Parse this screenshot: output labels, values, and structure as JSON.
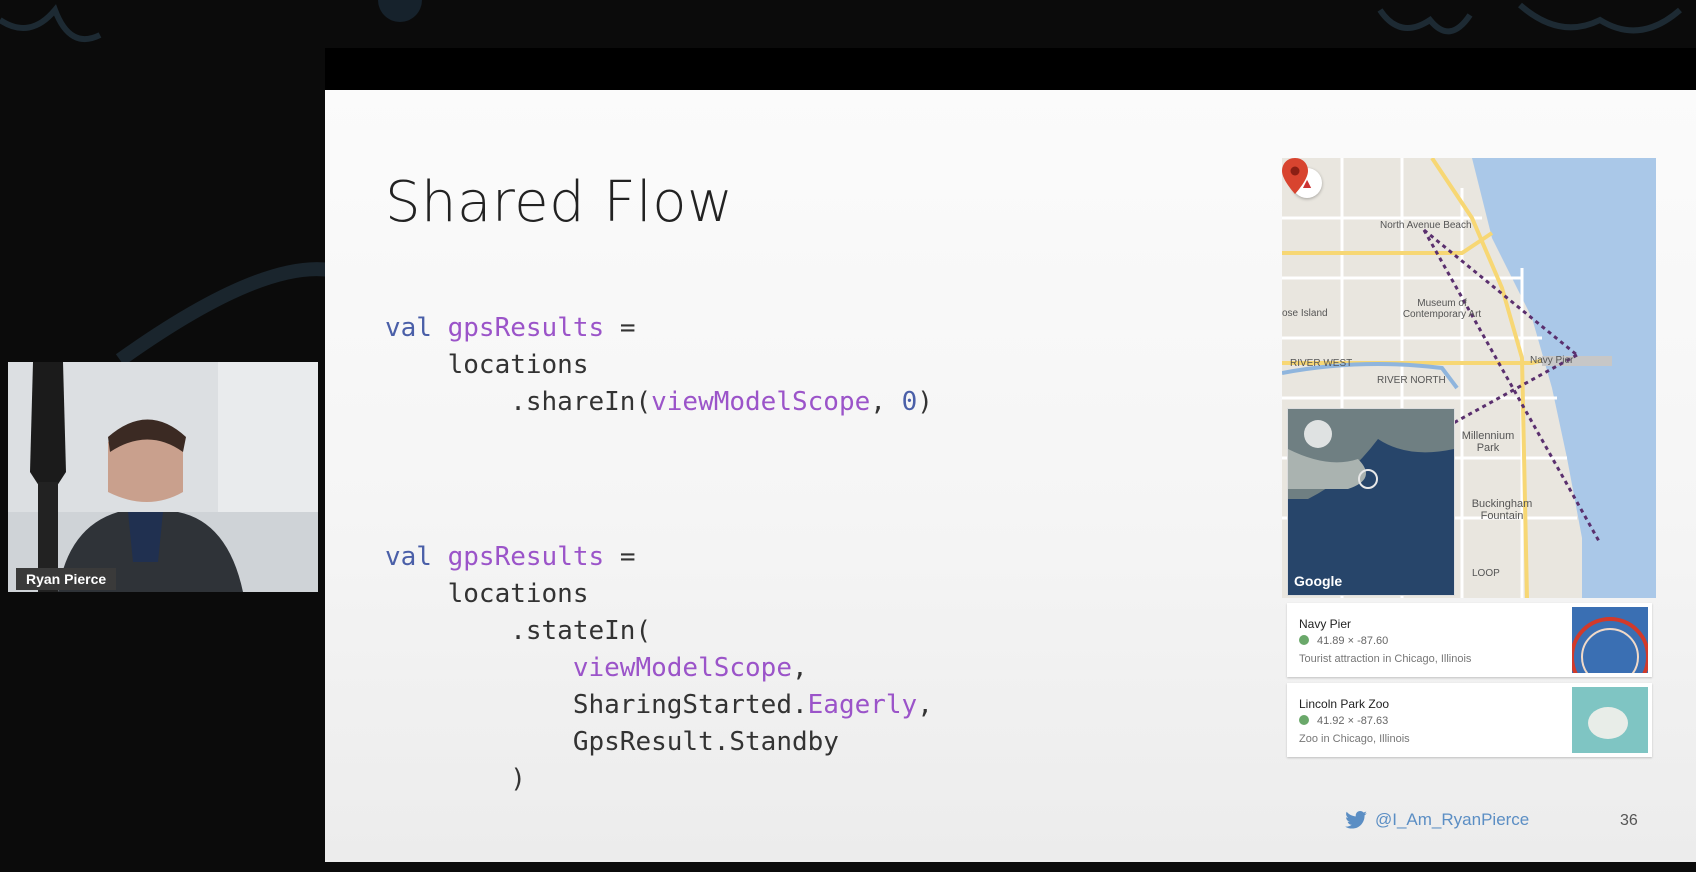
{
  "slide": {
    "title": "Shared Flow",
    "code_block_1": [
      [
        {
          "t": "val",
          "c": "kw"
        },
        {
          "t": " "
        },
        {
          "t": "gpsResults",
          "c": "id"
        },
        {
          "t": " ="
        }
      ],
      [
        {
          "t": "    locations"
        }
      ],
      [
        {
          "t": "        .shareIn("
        },
        {
          "t": "viewModelScope",
          "c": "id"
        },
        {
          "t": ", "
        },
        {
          "t": "0",
          "c": "num"
        },
        {
          "t": ")"
        }
      ]
    ],
    "code_block_2": [
      [
        {
          "t": "val",
          "c": "kw"
        },
        {
          "t": " "
        },
        {
          "t": "gpsResults",
          "c": "id"
        },
        {
          "t": " ="
        }
      ],
      [
        {
          "t": "    locations"
        }
      ],
      [
        {
          "t": "        .stateIn("
        }
      ],
      [
        {
          "t": "            "
        },
        {
          "t": "viewModelScope",
          "c": "id"
        },
        {
          "t": ","
        }
      ],
      [
        {
          "t": "            SharingStarted."
        },
        {
          "t": "Eagerly",
          "c": "id"
        },
        {
          "t": ","
        }
      ],
      [
        {
          "t": "            GpsResult.Standby"
        }
      ],
      [
        {
          "t": "        )"
        }
      ]
    ],
    "map": {
      "labels": {
        "north_avenue_beach": "North Avenue Beach",
        "museum": "Museum of Contemporary Art",
        "goose_island": "ose Island",
        "river_west": "RIVER WEST",
        "river_north": "RIVER NORTH",
        "navy_pier": "Navy Pier",
        "millennium_park": "Millennium Park",
        "buckingham": "Buckingham Fountain",
        "loop": "LOOP"
      },
      "google_logo": "Google",
      "compass_icon": "compass-icon"
    },
    "places": [
      {
        "name": "Navy Pier",
        "coords": "41.89  ×  -87.60",
        "description": "Tourist attraction in Chicago, Illinois"
      },
      {
        "name": "Lincoln Park Zoo",
        "coords": "41.92  ×  -87.63",
        "description": "Zoo in Chicago, Illinois"
      }
    ],
    "footer": {
      "handle": "@I_Am_RyanPierce",
      "page_number": "36",
      "social_icon": "twitter-bird-icon"
    }
  },
  "webcam": {
    "name": "Ryan Pierce"
  },
  "colors": {
    "keyword": "#4a5fa8",
    "identifier": "#9b54c9",
    "twitter": "#5b8ec4",
    "pin": "#d8442f"
  }
}
